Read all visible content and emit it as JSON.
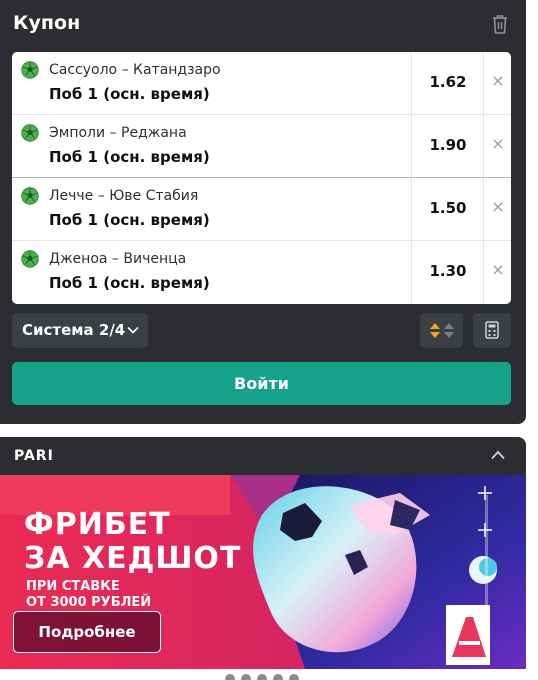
{
  "coupon": {
    "title": "Купон",
    "bets": [
      {
        "match": "Сассуоло – Катандзаро",
        "market": "Поб 1 (осн. время)",
        "odds": "1.62"
      },
      {
        "match": "Эмполи – Реджана",
        "market": "Поб 1 (осн. время)",
        "odds": "1.90"
      },
      {
        "match": "Лечче – Юве Стабия",
        "market": "Поб 1 (осн. время)",
        "odds": "1.50"
      },
      {
        "match": "Дженоа – Виченца",
        "market": "Поб 1 (осн. время)",
        "odds": "1.30"
      }
    ],
    "remove_symbol": "×",
    "system_label": "Система 2/4",
    "login_label": "Войти",
    "colors": {
      "panel": "#2b2d30",
      "accent": "#15a28a",
      "ball": "#4caf50"
    }
  },
  "promo": {
    "section_title": "PARI",
    "headline_1": "ФРИБЕТ",
    "headline_2": "ЗА ХЕДШОТ",
    "sub_1": "ПРИ СТАВКЕ",
    "sub_2": "ОТ 3000 РУБЛЕЙ",
    "button_label": "Подробнее"
  },
  "icons": [
    "trash-icon",
    "soccer-ball-icon",
    "close-icon",
    "chevron-down-icon",
    "sort-arrows-icon",
    "calculator-icon",
    "chevron-up-icon"
  ]
}
